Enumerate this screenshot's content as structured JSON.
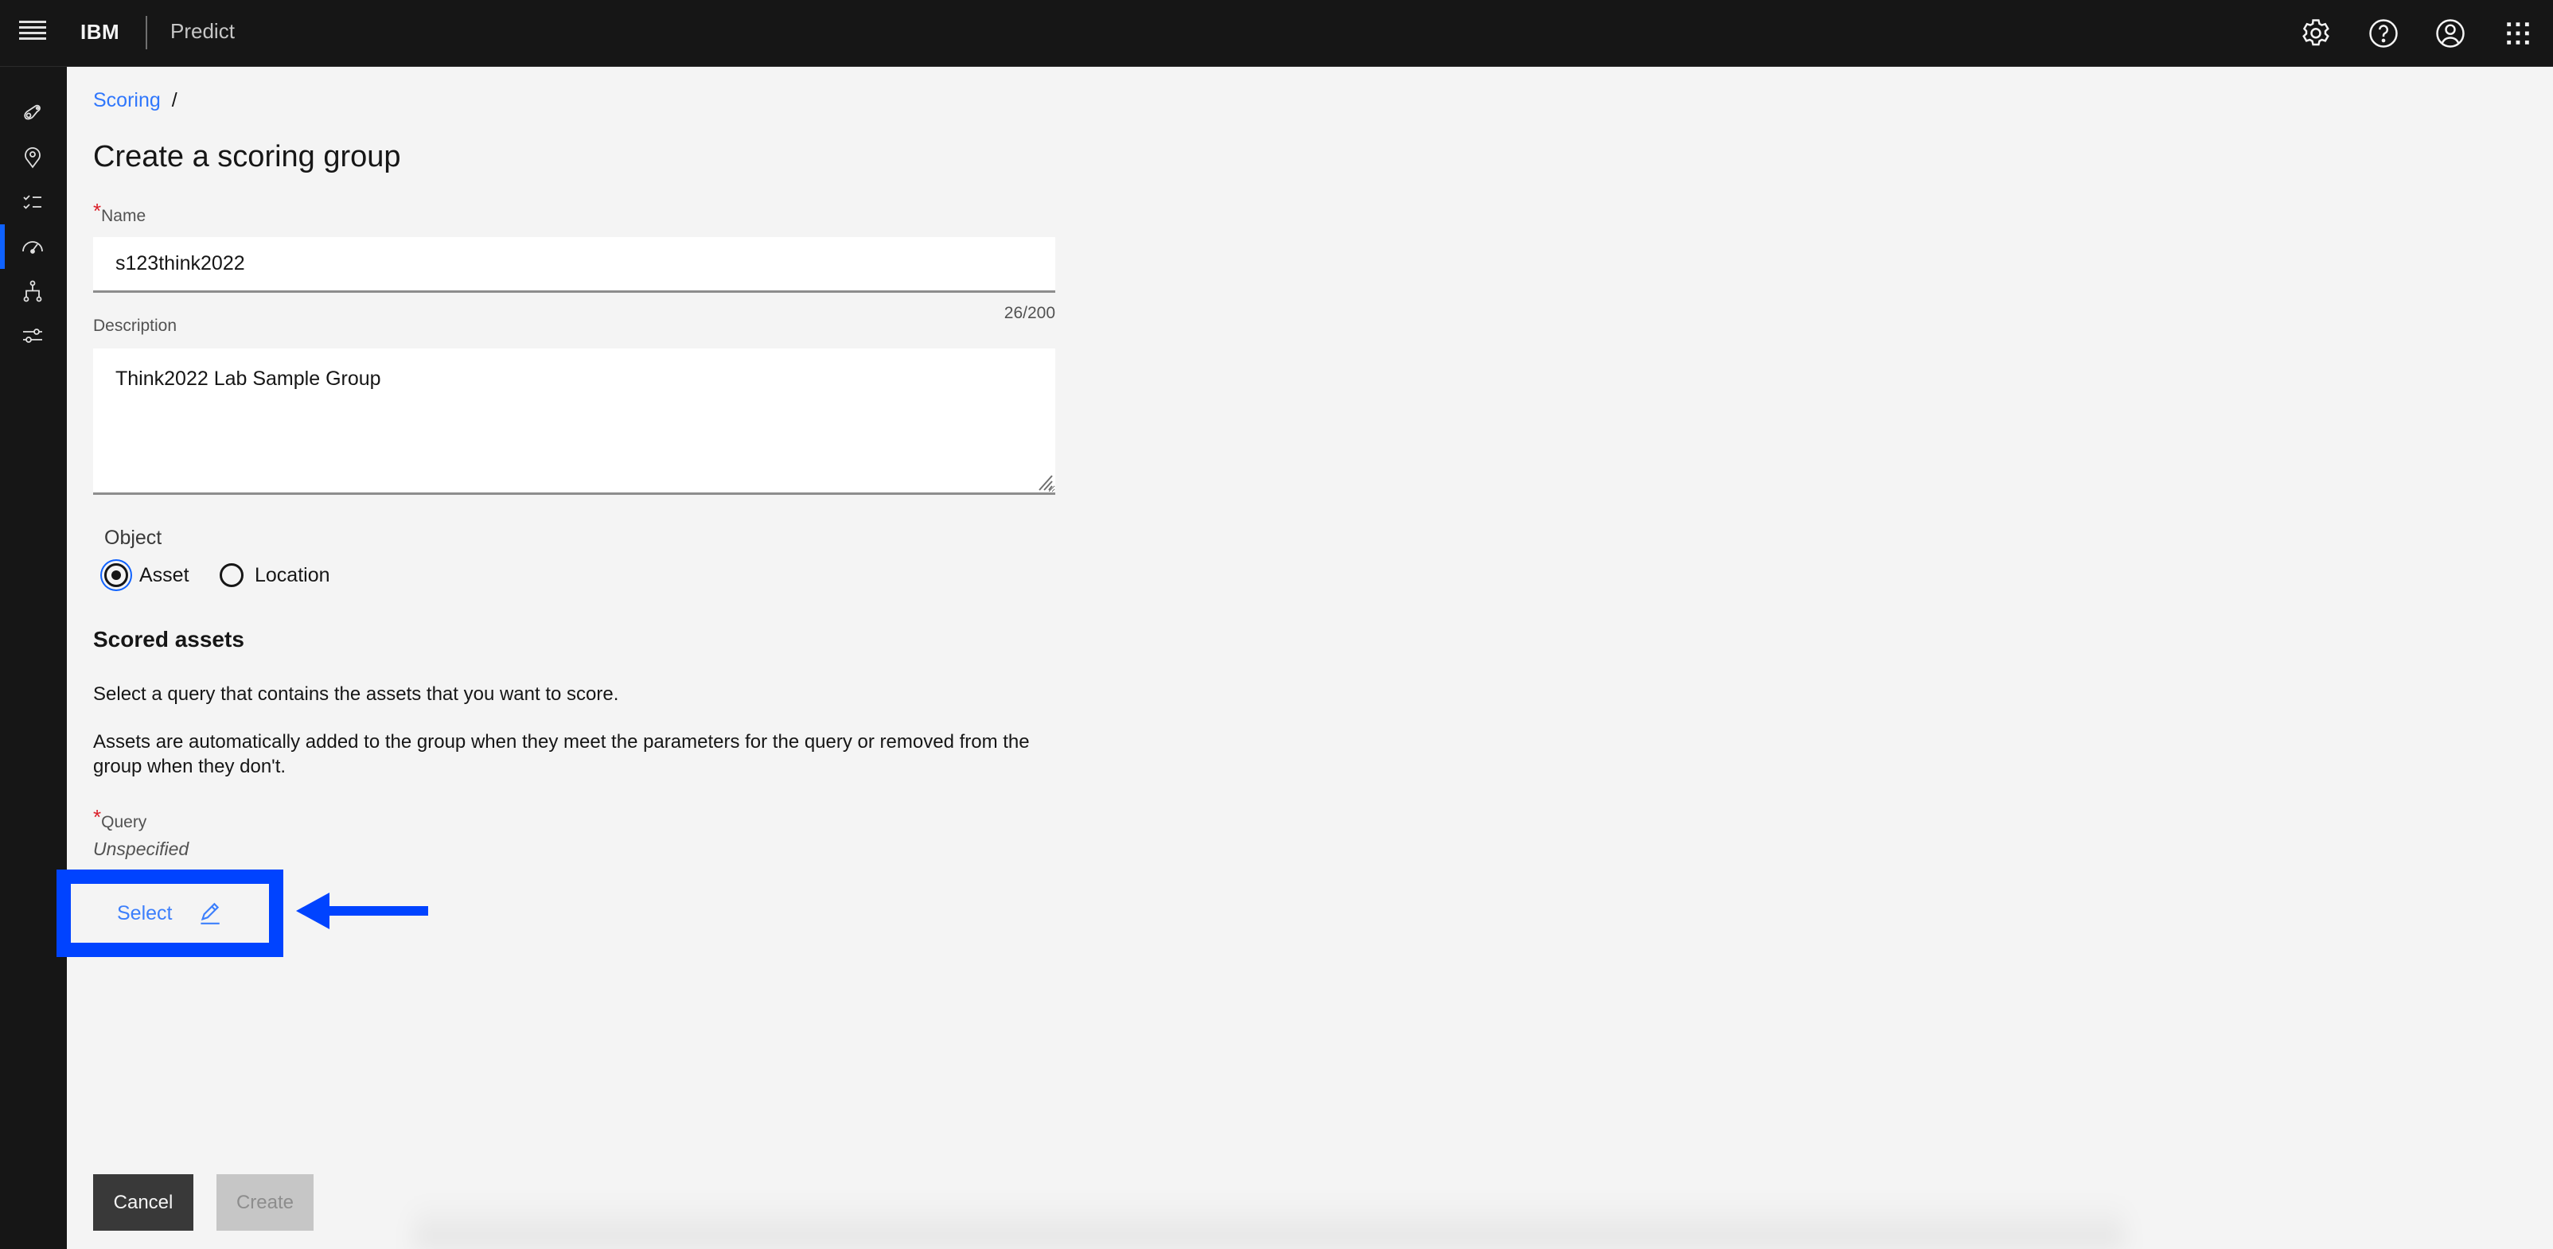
{
  "header": {
    "brand": "IBM",
    "product": "Predict",
    "icons": [
      "menu-icon",
      "settings-icon",
      "help-icon",
      "user-profile-icon",
      "app-switcher-icon"
    ]
  },
  "sidenav": {
    "items": [
      {
        "name": "assets",
        "icon": "asset-icon",
        "active": false
      },
      {
        "name": "locations",
        "icon": "location-icon",
        "active": false
      },
      {
        "name": "checklist",
        "icon": "checklist-icon",
        "active": false
      },
      {
        "name": "scoring",
        "icon": "gauge-icon",
        "active": true
      },
      {
        "name": "hierarchy",
        "icon": "hierarchy-icon",
        "active": false
      },
      {
        "name": "settings",
        "icon": "sliders-icon",
        "active": false
      }
    ]
  },
  "breadcrumb": {
    "items": [
      {
        "label": "Scoring"
      }
    ],
    "separator": "/"
  },
  "page": {
    "title": "Create a scoring group"
  },
  "form": {
    "name": {
      "required_mark": "*",
      "label": "Name",
      "value": "s123think2022",
      "counter": "26/200"
    },
    "description": {
      "label": "Description",
      "value": "Think2022 Lab Sample Group"
    },
    "object": {
      "label": "Object",
      "options": [
        {
          "label": "Asset",
          "checked": true
        },
        {
          "label": "Location",
          "checked": false
        }
      ]
    },
    "scored_assets": {
      "heading": "Scored assets",
      "help_1": "Select a query that contains the assets that you want to score.",
      "help_2": "Assets are automatically added to the group when they meet the parameters for the query or removed from the group when they don't."
    },
    "query": {
      "required_mark": "*",
      "label": "Query",
      "value": "Unspecified",
      "select_label": "Select",
      "select_icon": "edit-pencil-icon"
    }
  },
  "annotation": {
    "highlight_color": "#0043ff",
    "arrow": "left-arrow"
  },
  "actions": {
    "cancel": "Cancel",
    "create": "Create",
    "create_disabled": true
  },
  "colors": {
    "header_bg": "#161616",
    "page_bg": "#f4f4f4",
    "link": "#0f62fe",
    "required": "#da1e28",
    "primary_dark": "#393939",
    "disabled": "#c6c6c6"
  }
}
